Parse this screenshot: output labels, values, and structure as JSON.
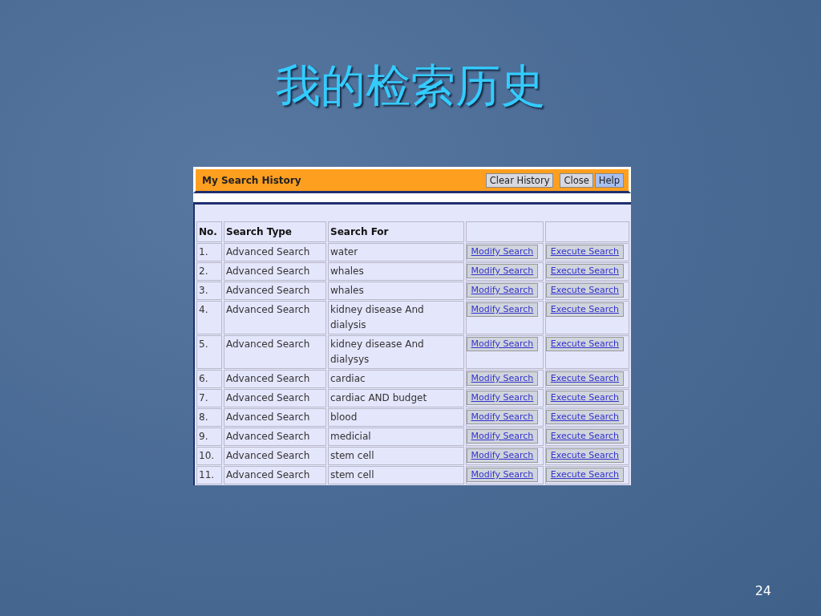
{
  "slide": {
    "title": "我的检索历史",
    "page_number": "24"
  },
  "panel": {
    "title": "My Search History",
    "buttons": [
      {
        "label": "Clear History",
        "highlighted": false
      },
      {
        "label": "Close",
        "highlighted": false
      },
      {
        "label": "Help",
        "highlighted": true
      }
    ]
  },
  "table": {
    "columns": [
      "No.",
      "Search Type",
      "Search For"
    ],
    "rows": [
      {
        "no": "1.",
        "type": "Advanced Search",
        "search_for": "water",
        "modify": "Modify Search",
        "execute": "Execute Search"
      },
      {
        "no": "2.",
        "type": "Advanced Search",
        "search_for": "whales",
        "modify": "Modify Search",
        "execute": "Execute Search"
      },
      {
        "no": "3.",
        "type": "Advanced Search",
        "search_for": "whales",
        "modify": "Modify Search",
        "execute": "Execute Search"
      },
      {
        "no": "4.",
        "type": "Advanced Search",
        "search_for": "kidney disease And dialysis",
        "modify": "Modify Search",
        "execute": "Execute Search"
      },
      {
        "no": "5.",
        "type": "Advanced Search",
        "search_for": "kidney disease And dialysys",
        "modify": "Modify Search",
        "execute": "Execute Search"
      },
      {
        "no": "6.",
        "type": "Advanced Search",
        "search_for": "cardiac",
        "modify": "Modify Search",
        "execute": "Execute Search"
      },
      {
        "no": "7.",
        "type": "Advanced Search",
        "search_for": "cardiac AND budget",
        "modify": "Modify Search",
        "execute": "Execute Search"
      },
      {
        "no": "8.",
        "type": "Advanced Search",
        "search_for": "blood",
        "modify": "Modify Search",
        "execute": "Execute Search"
      },
      {
        "no": "9.",
        "type": "Advanced Search",
        "search_for": "medicial",
        "modify": "Modify Search",
        "execute": "Execute Search"
      },
      {
        "no": "10.",
        "type": "Advanced Search",
        "search_for": "stem cell",
        "modify": "Modify Search",
        "execute": "Execute Search"
      },
      {
        "no": "11.",
        "type": "Advanced Search",
        "search_for": "stem cell",
        "modify": "Modify Search",
        "execute": "Execute Search"
      }
    ]
  }
}
